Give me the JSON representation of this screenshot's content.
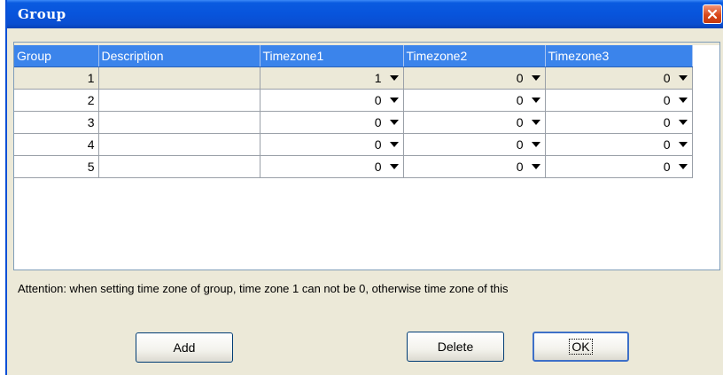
{
  "window": {
    "title": "Group"
  },
  "grid": {
    "columns": [
      "Group",
      "Description",
      "Timezone1",
      "Timezone2",
      "Timezone3"
    ],
    "rows": [
      {
        "group": "1",
        "description": "",
        "tz1": "1",
        "tz2": "0",
        "tz3": "0"
      },
      {
        "group": "2",
        "description": "",
        "tz1": "0",
        "tz2": "0",
        "tz3": "0"
      },
      {
        "group": "3",
        "description": "",
        "tz1": "0",
        "tz2": "0",
        "tz3": "0"
      },
      {
        "group": "4",
        "description": "",
        "tz1": "0",
        "tz2": "0",
        "tz3": "0"
      },
      {
        "group": "5",
        "description": "",
        "tz1": "0",
        "tz2": "0",
        "tz3": "0"
      }
    ]
  },
  "attention": "Attention: when setting time zone of group, time zone 1 can not be 0, otherwise time zone of this",
  "buttons": {
    "add": "Add",
    "delete": "Delete",
    "ok": "OK"
  },
  "colors": {
    "header": "#3b84eb",
    "titlebar": "#0854dc",
    "selected_row": "#ece9d8"
  },
  "icons": {
    "close": "close-icon",
    "dropdown": "dropdown-arrow-icon"
  }
}
